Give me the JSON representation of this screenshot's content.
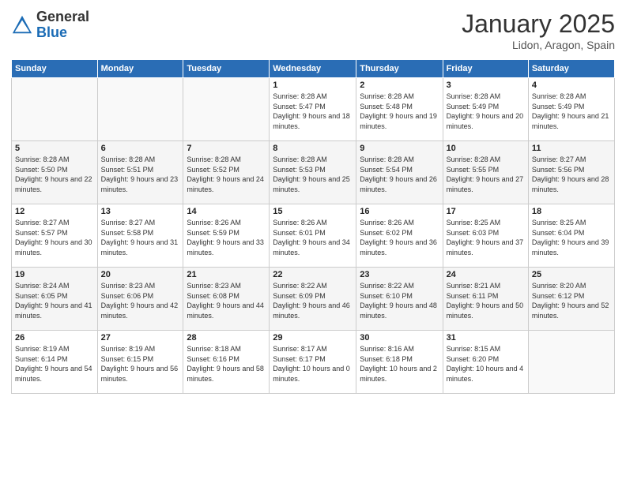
{
  "header": {
    "logo_general": "General",
    "logo_blue": "Blue",
    "month_title": "January 2025",
    "subtitle": "Lidon, Aragon, Spain"
  },
  "days_of_week": [
    "Sunday",
    "Monday",
    "Tuesday",
    "Wednesday",
    "Thursday",
    "Friday",
    "Saturday"
  ],
  "weeks": [
    [
      {
        "day": "",
        "info": ""
      },
      {
        "day": "",
        "info": ""
      },
      {
        "day": "",
        "info": ""
      },
      {
        "day": "1",
        "info": "Sunrise: 8:28 AM\nSunset: 5:47 PM\nDaylight: 9 hours\nand 18 minutes."
      },
      {
        "day": "2",
        "info": "Sunrise: 8:28 AM\nSunset: 5:48 PM\nDaylight: 9 hours\nand 19 minutes."
      },
      {
        "day": "3",
        "info": "Sunrise: 8:28 AM\nSunset: 5:49 PM\nDaylight: 9 hours\nand 20 minutes."
      },
      {
        "day": "4",
        "info": "Sunrise: 8:28 AM\nSunset: 5:49 PM\nDaylight: 9 hours\nand 21 minutes."
      }
    ],
    [
      {
        "day": "5",
        "info": "Sunrise: 8:28 AM\nSunset: 5:50 PM\nDaylight: 9 hours\nand 22 minutes."
      },
      {
        "day": "6",
        "info": "Sunrise: 8:28 AM\nSunset: 5:51 PM\nDaylight: 9 hours\nand 23 minutes."
      },
      {
        "day": "7",
        "info": "Sunrise: 8:28 AM\nSunset: 5:52 PM\nDaylight: 9 hours\nand 24 minutes."
      },
      {
        "day": "8",
        "info": "Sunrise: 8:28 AM\nSunset: 5:53 PM\nDaylight: 9 hours\nand 25 minutes."
      },
      {
        "day": "9",
        "info": "Sunrise: 8:28 AM\nSunset: 5:54 PM\nDaylight: 9 hours\nand 26 minutes."
      },
      {
        "day": "10",
        "info": "Sunrise: 8:28 AM\nSunset: 5:55 PM\nDaylight: 9 hours\nand 27 minutes."
      },
      {
        "day": "11",
        "info": "Sunrise: 8:27 AM\nSunset: 5:56 PM\nDaylight: 9 hours\nand 28 minutes."
      }
    ],
    [
      {
        "day": "12",
        "info": "Sunrise: 8:27 AM\nSunset: 5:57 PM\nDaylight: 9 hours\nand 30 minutes."
      },
      {
        "day": "13",
        "info": "Sunrise: 8:27 AM\nSunset: 5:58 PM\nDaylight: 9 hours\nand 31 minutes."
      },
      {
        "day": "14",
        "info": "Sunrise: 8:26 AM\nSunset: 5:59 PM\nDaylight: 9 hours\nand 33 minutes."
      },
      {
        "day": "15",
        "info": "Sunrise: 8:26 AM\nSunset: 6:01 PM\nDaylight: 9 hours\nand 34 minutes."
      },
      {
        "day": "16",
        "info": "Sunrise: 8:26 AM\nSunset: 6:02 PM\nDaylight: 9 hours\nand 36 minutes."
      },
      {
        "day": "17",
        "info": "Sunrise: 8:25 AM\nSunset: 6:03 PM\nDaylight: 9 hours\nand 37 minutes."
      },
      {
        "day": "18",
        "info": "Sunrise: 8:25 AM\nSunset: 6:04 PM\nDaylight: 9 hours\nand 39 minutes."
      }
    ],
    [
      {
        "day": "19",
        "info": "Sunrise: 8:24 AM\nSunset: 6:05 PM\nDaylight: 9 hours\nand 41 minutes."
      },
      {
        "day": "20",
        "info": "Sunrise: 8:23 AM\nSunset: 6:06 PM\nDaylight: 9 hours\nand 42 minutes."
      },
      {
        "day": "21",
        "info": "Sunrise: 8:23 AM\nSunset: 6:08 PM\nDaylight: 9 hours\nand 44 minutes."
      },
      {
        "day": "22",
        "info": "Sunrise: 8:22 AM\nSunset: 6:09 PM\nDaylight: 9 hours\nand 46 minutes."
      },
      {
        "day": "23",
        "info": "Sunrise: 8:22 AM\nSunset: 6:10 PM\nDaylight: 9 hours\nand 48 minutes."
      },
      {
        "day": "24",
        "info": "Sunrise: 8:21 AM\nSunset: 6:11 PM\nDaylight: 9 hours\nand 50 minutes."
      },
      {
        "day": "25",
        "info": "Sunrise: 8:20 AM\nSunset: 6:12 PM\nDaylight: 9 hours\nand 52 minutes."
      }
    ],
    [
      {
        "day": "26",
        "info": "Sunrise: 8:19 AM\nSunset: 6:14 PM\nDaylight: 9 hours\nand 54 minutes."
      },
      {
        "day": "27",
        "info": "Sunrise: 8:19 AM\nSunset: 6:15 PM\nDaylight: 9 hours\nand 56 minutes."
      },
      {
        "day": "28",
        "info": "Sunrise: 8:18 AM\nSunset: 6:16 PM\nDaylight: 9 hours\nand 58 minutes."
      },
      {
        "day": "29",
        "info": "Sunrise: 8:17 AM\nSunset: 6:17 PM\nDaylight: 10 hours\nand 0 minutes."
      },
      {
        "day": "30",
        "info": "Sunrise: 8:16 AM\nSunset: 6:18 PM\nDaylight: 10 hours\nand 2 minutes."
      },
      {
        "day": "31",
        "info": "Sunrise: 8:15 AM\nSunset: 6:20 PM\nDaylight: 10 hours\nand 4 minutes."
      },
      {
        "day": "",
        "info": ""
      }
    ]
  ]
}
